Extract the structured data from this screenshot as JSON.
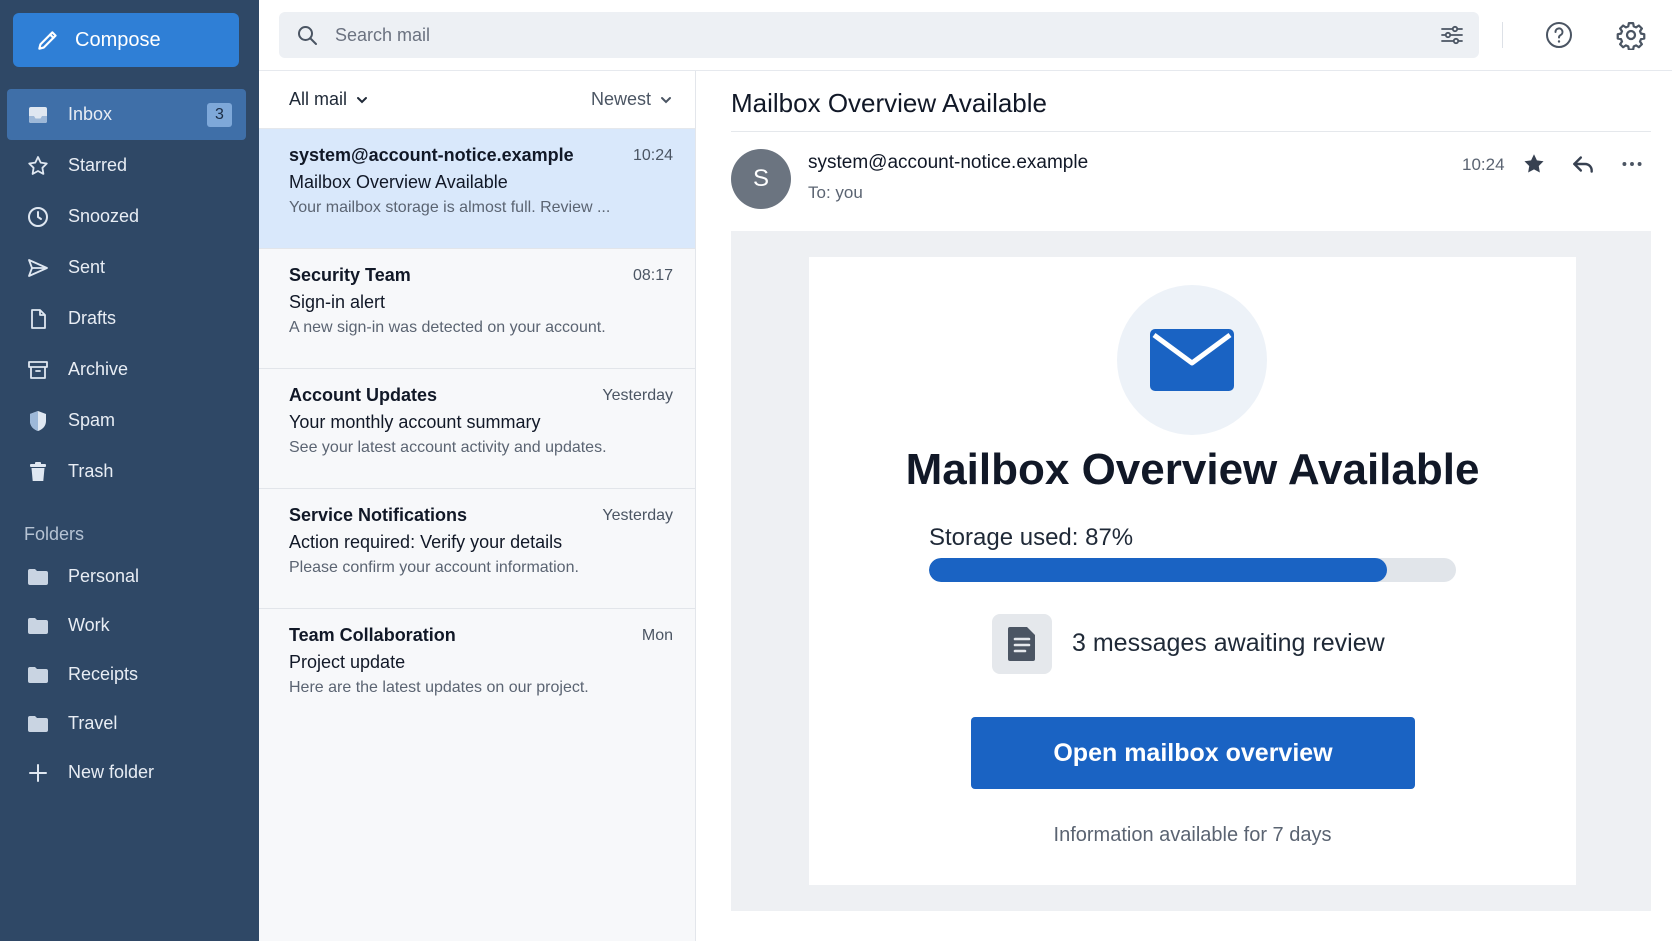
{
  "sidebar": {
    "compose_label": "Compose",
    "nav": [
      {
        "label": "Inbox",
        "icon": "inbox-icon",
        "badge": "3",
        "active": true
      },
      {
        "label": "Starred",
        "icon": "star-icon"
      },
      {
        "label": "Snoozed",
        "icon": "clock-icon"
      },
      {
        "label": "Sent",
        "icon": "send-icon"
      },
      {
        "label": "Drafts",
        "icon": "draft-icon"
      },
      {
        "label": "Archive",
        "icon": "archive-icon"
      },
      {
        "label": "Spam",
        "icon": "shield-icon"
      },
      {
        "label": "Trash",
        "icon": "trash-icon"
      }
    ],
    "folders_heading": "Folders",
    "folders": [
      {
        "label": "Personal"
      },
      {
        "label": "Work"
      },
      {
        "label": "Receipts"
      },
      {
        "label": "Travel"
      }
    ],
    "new_folder_label": "New folder"
  },
  "search": {
    "placeholder": "Search mail"
  },
  "list": {
    "filter_label": "All mail",
    "sort_label": "Newest",
    "messages": [
      {
        "from": "system@account-notice.example",
        "time": "10:24",
        "subject": "Mailbox Overview Available",
        "snippet": "Your mailbox storage is almost full. Review ...",
        "selected": true
      },
      {
        "from": "Security Team",
        "time": "08:17",
        "subject": "Sign-in alert",
        "snippet": "A new sign-in was detected on your account."
      },
      {
        "from": "Account Updates",
        "time": "Yesterday",
        "subject": "Your monthly account summary",
        "snippet": "See your latest account activity and updates."
      },
      {
        "from": "Service Notifications",
        "time": "Yesterday",
        "subject": "Action required: Verify your details",
        "snippet": "Please confirm your account information."
      },
      {
        "from": "Team Collaboration",
        "time": "Mon",
        "subject": "Project update",
        "snippet": "Here are the latest updates on our project."
      }
    ]
  },
  "reader": {
    "title": "Mailbox Overview Available",
    "avatar_letter": "S",
    "sender": "system@account-notice.example",
    "recipient": "To: you",
    "time": "10:24",
    "body": {
      "heading": "Mailbox Overview Available",
      "storage_label": "Storage used:",
      "storage_value": "87%",
      "storage_fraction": 0.87,
      "awaiting_text": "3 messages awaiting review",
      "cta_label": "Open mailbox overview",
      "availability_text": "Information available for 7 days"
    }
  },
  "colors": {
    "sidebar_bg": "#2f4866",
    "compose_bg": "#2f7fd6",
    "accent_blue": "#1a63c3",
    "selected_row": "#d9e8fb"
  }
}
